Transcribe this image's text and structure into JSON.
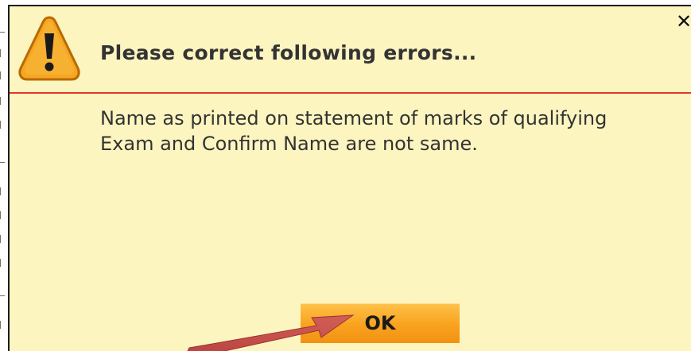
{
  "dialog": {
    "title": "Please correct following errors...",
    "message": "Name as printed on statement of marks of qualifying Exam and Confirm Name are not same.",
    "close_symbol": "✕",
    "ok_label": "OK"
  },
  "icons": {
    "warning": "warning-icon",
    "close": "close-icon"
  },
  "colors": {
    "dialog_background": "#fdf5c0",
    "header_divider": "#e8342a",
    "button_top": "#ffc24a",
    "button_bottom": "#f29112",
    "warning_fill": "#f5a623",
    "annotation_arrow": "#c0504d"
  }
}
